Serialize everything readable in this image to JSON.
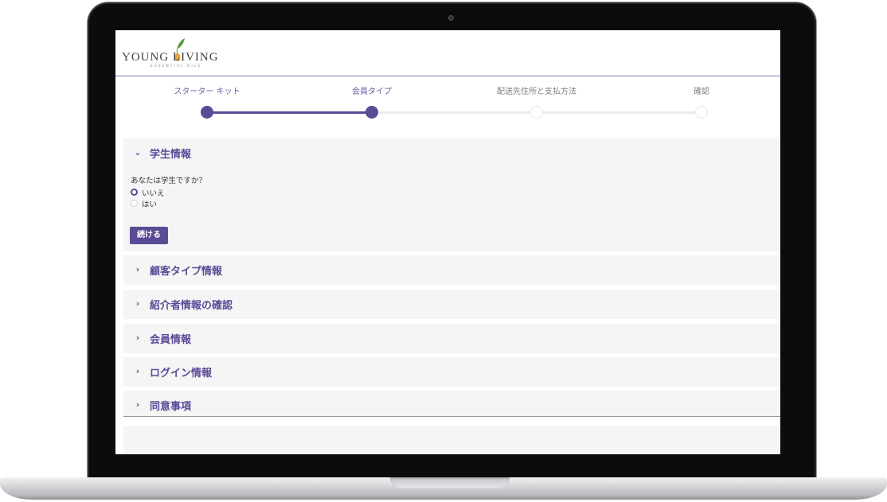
{
  "brand": {
    "logo_text": "YOUNG LIVING",
    "logo_subtext": "ESSENTIAL OILS",
    "accent_color": "#5b4a96"
  },
  "stepper": {
    "steps": [
      {
        "label": "スターター キット",
        "state": "complete"
      },
      {
        "label": "会員タイプ",
        "state": "current"
      },
      {
        "label": "配送先住所と支払方法",
        "state": "upcoming"
      },
      {
        "label": "確認",
        "state": "upcoming"
      }
    ]
  },
  "sections": [
    {
      "title": "学生情報",
      "expanded": true,
      "question": "あなたは学生ですか？",
      "options": [
        {
          "label": "いいえ",
          "selected": true
        },
        {
          "label": "はい",
          "selected": false
        }
      ],
      "continue_label": "続ける"
    },
    {
      "title": "顧客タイプ情報",
      "expanded": false
    },
    {
      "title": "紹介者情報の確認",
      "expanded": false
    },
    {
      "title": "会員情報",
      "expanded": false
    },
    {
      "title": "ログイン情報",
      "expanded": false
    },
    {
      "title": "同意事項",
      "expanded": false
    }
  ],
  "icons": {
    "expanded": "chevron-down-icon",
    "collapsed": "chevron-right-icon"
  }
}
